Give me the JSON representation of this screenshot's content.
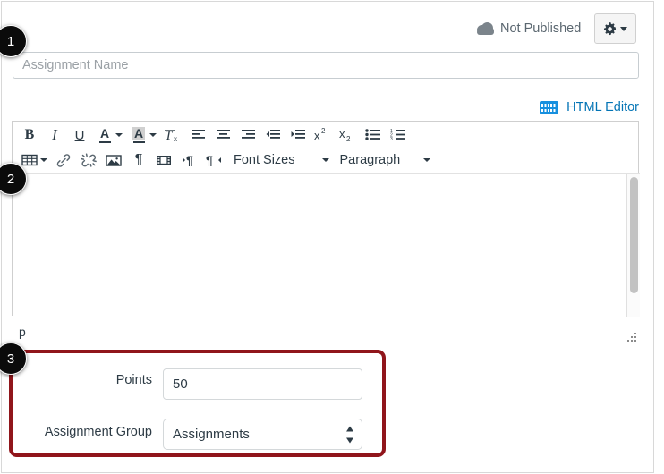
{
  "header": {
    "publish_status": "Not Published",
    "publish_icon": "cloud-icon",
    "settings_icon": "gear-icon",
    "settings_caret_icon": "chevron-down-icon"
  },
  "name_field": {
    "placeholder": "Assignment Name",
    "value": ""
  },
  "rce": {
    "html_editor_link": "HTML Editor",
    "html_editor_icon": "keyboard-icon",
    "content": "",
    "path_indicator": "p",
    "resize_handle_icon": "resize-grip-icon",
    "scrollbar": "vertical-scrollbar",
    "toolbar_row_1": [
      {
        "name": "bold-button",
        "glyph": "B",
        "style": "bold",
        "caret": false
      },
      {
        "name": "italic-button",
        "glyph": "I",
        "style": "italic",
        "caret": false
      },
      {
        "name": "underline-button",
        "glyph": "U",
        "style": "underline",
        "caret": false
      },
      {
        "name": "text-color-button",
        "glyph": "A",
        "style": "fontcolor",
        "caret": true
      },
      {
        "name": "highlight-color-button",
        "glyph": "A",
        "style": "highlight",
        "caret": true
      },
      {
        "name": "clear-formatting-button",
        "glyph": "Tx",
        "style": "icon",
        "caret": false
      },
      {
        "name": "align-left-button",
        "glyph": "align-left",
        "style": "icon",
        "caret": false
      },
      {
        "name": "align-center-button",
        "glyph": "align-center",
        "style": "icon",
        "caret": false
      },
      {
        "name": "align-right-button",
        "glyph": "align-right",
        "style": "icon",
        "caret": false
      },
      {
        "name": "outdent-button",
        "glyph": "outdent",
        "style": "icon",
        "caret": false
      },
      {
        "name": "indent-button",
        "glyph": "indent",
        "style": "icon",
        "caret": false
      },
      {
        "name": "superscript-button",
        "glyph": "x2-sup",
        "style": "icon",
        "caret": false
      },
      {
        "name": "subscript-button",
        "glyph": "x2-sub",
        "style": "icon",
        "caret": false
      },
      {
        "name": "bulleted-list-button",
        "glyph": "ul",
        "style": "icon",
        "caret": false
      },
      {
        "name": "numbered-list-button",
        "glyph": "ol",
        "style": "icon",
        "caret": false
      }
    ],
    "toolbar_row_2": [
      {
        "name": "table-button",
        "glyph": "table",
        "caret": true
      },
      {
        "name": "insert-link-button",
        "glyph": "link",
        "caret": false
      },
      {
        "name": "unlink-button",
        "glyph": "unlink",
        "caret": false
      },
      {
        "name": "insert-image-button",
        "glyph": "image",
        "caret": false
      },
      {
        "name": "show-blocks-button",
        "glyph": "pilcrow",
        "caret": false
      },
      {
        "name": "insert-media-button",
        "glyph": "film",
        "caret": false
      },
      {
        "name": "ltr-button",
        "glyph": "ltr",
        "caret": false
      },
      {
        "name": "rtl-button",
        "glyph": "rtl",
        "caret": false
      }
    ],
    "font_sizes_label": "Font Sizes",
    "paragraph_label": "Paragraph"
  },
  "details": {
    "points_label": "Points",
    "points_value": "50",
    "assignment_group_label": "Assignment Group",
    "assignment_group_value": "Assignments",
    "assignment_group_options": [
      "Assignments"
    ]
  },
  "annotations": {
    "badges": [
      "1",
      "2",
      "3"
    ],
    "highlight_color": "#90151b"
  }
}
